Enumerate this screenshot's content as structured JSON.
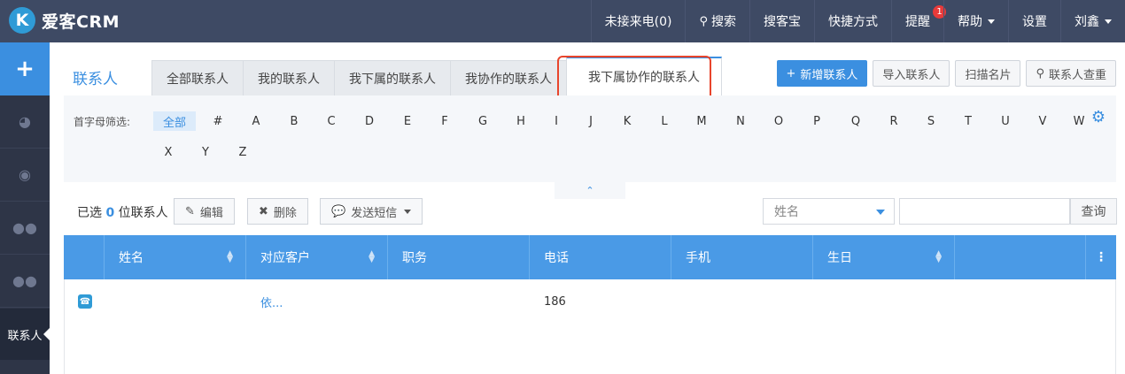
{
  "app": {
    "logo_letter": "K",
    "title": "爱客CRM"
  },
  "topnav": {
    "missed_calls": "未接来电(0)",
    "search": "搜索",
    "souke": "搜客宝",
    "shortcuts": "快捷方式",
    "reminders": "提醒",
    "reminder_count": "1",
    "help": "帮助",
    "settings": "设置",
    "user": "刘鑫"
  },
  "sidebar": {
    "add": "+",
    "active_item": "联系人"
  },
  "page": {
    "title": "联系人"
  },
  "tabs": [
    "全部联系人",
    "我的联系人",
    "我下属的联系人",
    "我协作的联系人",
    "我下属协作的联系人"
  ],
  "active_tab": "我下属协作的联系人",
  "header_buttons": {
    "add": "新增联系人",
    "import": "导入联系人",
    "scan": "扫描名片",
    "dedupe": "联系人查重"
  },
  "filter": {
    "label": "首字母筛选:",
    "letters_row1": [
      "全部",
      "#",
      "A",
      "B",
      "C",
      "D",
      "E",
      "F",
      "G",
      "H",
      "I",
      "J",
      "K",
      "L",
      "M",
      "N",
      "O",
      "P",
      "Q",
      "R",
      "S",
      "T",
      "U",
      "V",
      "W"
    ],
    "letters_row2": [
      "X",
      "Y",
      "Z"
    ],
    "active": "全部"
  },
  "toolbar": {
    "selected_prefix": "已选",
    "selected_count": "0",
    "selected_suffix": "位联系人",
    "edit": "编辑",
    "delete": "删除",
    "sms": "发送短信",
    "search_field": "姓名",
    "search_value": "",
    "query": "查询"
  },
  "table": {
    "columns": [
      "姓名",
      "对应客户",
      "职务",
      "电话",
      "手机",
      "生日"
    ],
    "rows": [
      {
        "name": "",
        "customer": "依...",
        "title": "",
        "phone": "186",
        "mobile": "",
        "birthday": ""
      }
    ]
  },
  "colors": {
    "accent": "#3b8fe0",
    "topbar": "#3e4a64",
    "sidebar": "#2e3547",
    "highlight": "#e8452c"
  }
}
